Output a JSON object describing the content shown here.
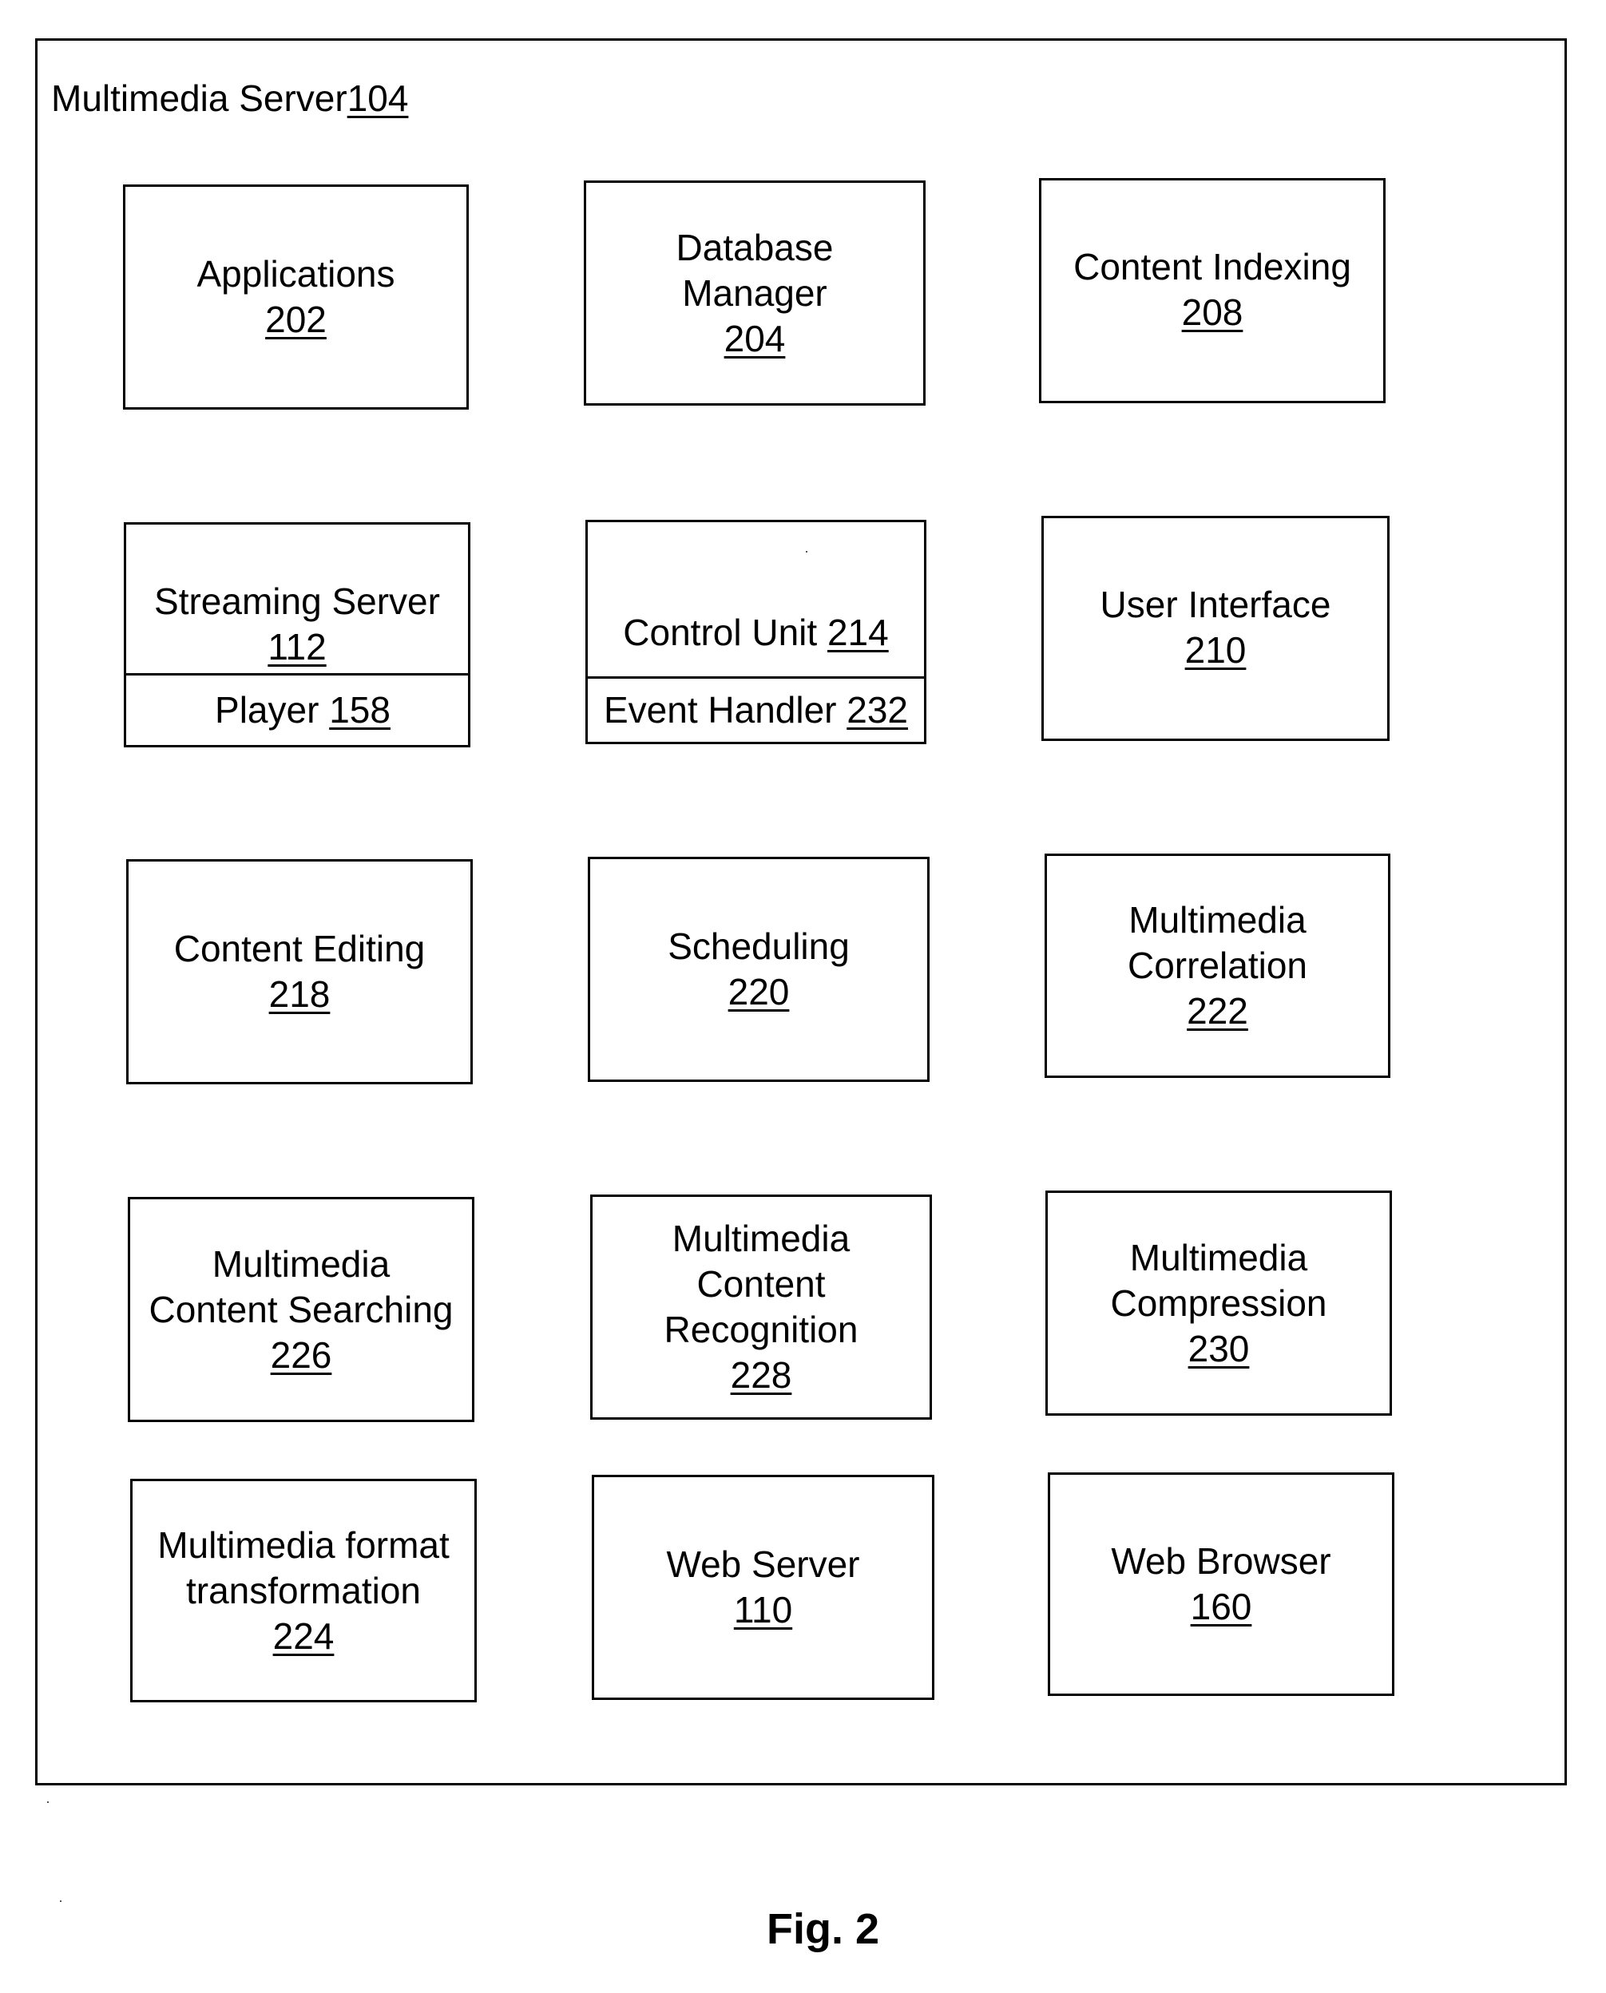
{
  "diagram": {
    "container": {
      "label": "Multimedia Server",
      "ref": "104"
    },
    "figure_caption": "Fig. 2",
    "components": {
      "applications": {
        "label": "Applications",
        "ref": "202"
      },
      "database_manager": {
        "label_line1": "Database",
        "label_line2": "Manager",
        "ref": "204"
      },
      "content_indexing": {
        "label": "Content Indexing",
        "ref": "208"
      },
      "streaming_server": {
        "label": "Streaming Server",
        "ref": "112",
        "sub": {
          "label": "Player",
          "ref": "158"
        }
      },
      "control_unit": {
        "label": "Control Unit",
        "ref": "214",
        "sub": {
          "label": "Event Handler",
          "ref": "232"
        }
      },
      "user_interface": {
        "label": "User Interface",
        "ref": "210"
      },
      "content_editing": {
        "label": "Content Editing",
        "ref": "218"
      },
      "scheduling": {
        "label": "Scheduling",
        "ref": "220"
      },
      "multimedia_correlation": {
        "label_line1": "Multimedia",
        "label_line2": "Correlation",
        "ref": "222"
      },
      "content_searching": {
        "label_line1": "Multimedia",
        "label_line2": "Content Searching",
        "ref": "226"
      },
      "content_recognition": {
        "label_line1": "Multimedia",
        "label_line2": "Content",
        "label_line3": "Recognition",
        "ref": "228"
      },
      "compression": {
        "label_line1": "Multimedia",
        "label_line2": "Compression",
        "ref": "230"
      },
      "format_transformation": {
        "label_line1": "Multimedia format",
        "label_line2": "transformation",
        "ref": "224"
      },
      "web_server": {
        "label": "Web Server",
        "ref": "110"
      },
      "web_browser": {
        "label": "Web Browser",
        "ref": "160"
      }
    }
  }
}
